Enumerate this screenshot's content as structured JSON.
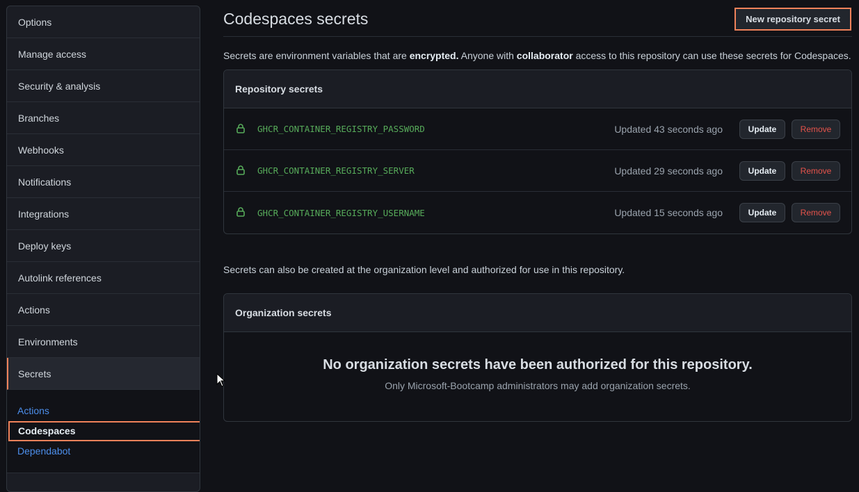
{
  "sidebar": {
    "items": [
      {
        "label": "Options"
      },
      {
        "label": "Manage access"
      },
      {
        "label": "Security & analysis"
      },
      {
        "label": "Branches"
      },
      {
        "label": "Webhooks"
      },
      {
        "label": "Notifications"
      },
      {
        "label": "Integrations"
      },
      {
        "label": "Deploy keys"
      },
      {
        "label": "Autolink references"
      },
      {
        "label": "Actions"
      },
      {
        "label": "Environments"
      },
      {
        "label": "Secrets",
        "selected": true
      }
    ],
    "subitems": [
      {
        "label": "Actions"
      },
      {
        "label": "Codespaces",
        "current": true
      },
      {
        "label": "Dependabot"
      }
    ]
  },
  "header": {
    "title": "Codespaces secrets",
    "new_secret_label": "New repository secret"
  },
  "intro": {
    "part1": "Secrets are environment variables that are ",
    "bold1": "encrypted.",
    "part2": " Anyone with ",
    "bold2": "collaborator",
    "part3": " access to this repository can use these secrets for Codespaces."
  },
  "repo_secrets": {
    "title": "Repository secrets",
    "update_label": "Update",
    "remove_label": "Remove",
    "rows": [
      {
        "name": "GHCR_CONTAINER_REGISTRY_PASSWORD",
        "updated": "Updated 43 seconds ago"
      },
      {
        "name": "GHCR_CONTAINER_REGISTRY_SERVER",
        "updated": "Updated 29 seconds ago"
      },
      {
        "name": "GHCR_CONTAINER_REGISTRY_USERNAME",
        "updated": "Updated 15 seconds ago"
      }
    ]
  },
  "org": {
    "intro": "Secrets can also be created at the organization level and authorized for use in this repository.",
    "title": "Organization secrets",
    "empty_title": "No organization secrets have been authorized for this repository.",
    "empty_sub": "Only Microsoft-Bootcamp administrators may add organization secrets."
  },
  "colors": {
    "accent_highlight": "#f0825a",
    "link": "#4c8eea",
    "secret_name": "#57ab5a",
    "danger": "#e5534b"
  }
}
